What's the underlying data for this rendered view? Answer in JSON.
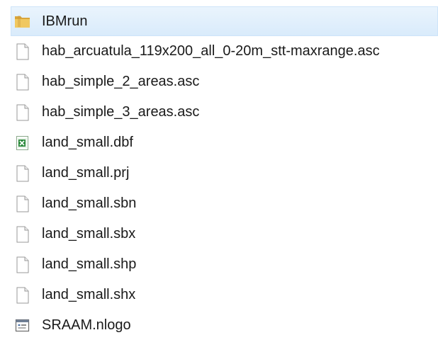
{
  "files": [
    {
      "name": "IBMrun",
      "icon": "folder-icon",
      "selected": true
    },
    {
      "name": "hab_arcuatula_119x200_all_0-20m_stt-maxrange.asc",
      "icon": "generic-file-icon",
      "selected": false
    },
    {
      "name": "hab_simple_2_areas.asc",
      "icon": "generic-file-icon",
      "selected": false
    },
    {
      "name": "hab_simple_3_areas.asc",
      "icon": "generic-file-icon",
      "selected": false
    },
    {
      "name": "land_small.dbf",
      "icon": "excel-file-icon",
      "selected": false
    },
    {
      "name": "land_small.prj",
      "icon": "generic-file-icon",
      "selected": false
    },
    {
      "name": "land_small.sbn",
      "icon": "generic-file-icon",
      "selected": false
    },
    {
      "name": "land_small.sbx",
      "icon": "generic-file-icon",
      "selected": false
    },
    {
      "name": "land_small.shp",
      "icon": "generic-file-icon",
      "selected": false
    },
    {
      "name": "land_small.shx",
      "icon": "generic-file-icon",
      "selected": false
    },
    {
      "name": "SRAAM.nlogo",
      "icon": "app-window-file-icon",
      "selected": false
    }
  ],
  "colors": {
    "selection_bg": "#d9ebfb",
    "selection_border": "#cde4f9",
    "folder": "#e8b84a",
    "excel_green": "#2e8b3e"
  }
}
